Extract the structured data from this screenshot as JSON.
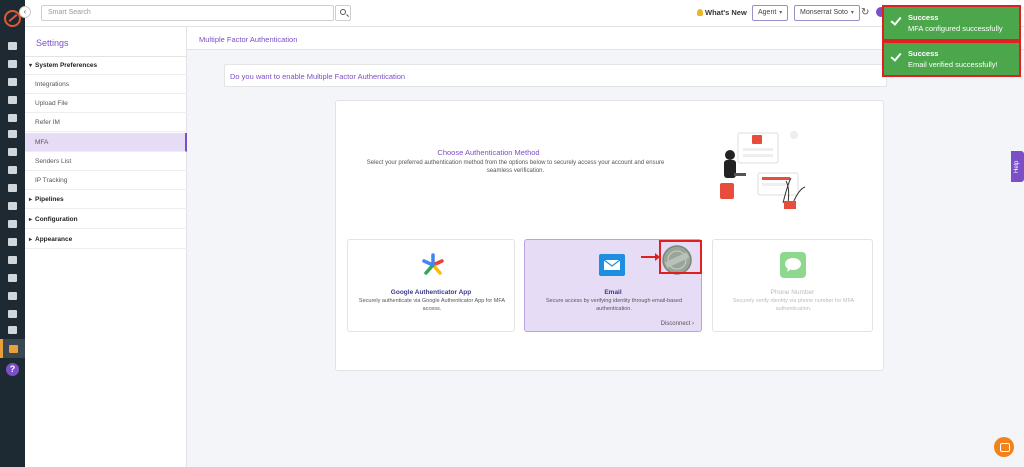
{
  "topbar": {
    "search_placeholder": "Smart Search",
    "whats_new": "What's New",
    "role_select": "Agent",
    "user_select": "Monserrat Soto"
  },
  "settings": {
    "title": "Settings",
    "items": [
      {
        "label": "System Preferences",
        "type": "group",
        "open": true
      },
      {
        "label": "Integrations",
        "type": "item"
      },
      {
        "label": "Upload File",
        "type": "item"
      },
      {
        "label": "Refer IM",
        "type": "item"
      },
      {
        "label": "MFA",
        "type": "item",
        "active": true
      },
      {
        "label": "Senders List",
        "type": "item"
      },
      {
        "label": "IP Tracking",
        "type": "item"
      },
      {
        "label": "Pipelines",
        "type": "group"
      },
      {
        "label": "Configuration",
        "type": "group"
      },
      {
        "label": "Appearance",
        "type": "group"
      }
    ]
  },
  "main": {
    "title": "Multiple Factor Authentication",
    "question": "Do you want to enable Multiple Factor Authentication",
    "method_title": "Choose Authentication Method",
    "method_subtitle": "Select your preferred authentication method from the options below to securely access your account and ensure seamless verification.",
    "options": [
      {
        "name": "Google Authenticator App",
        "desc": "Securely authenticate via Google Authenticator App for MFA access.",
        "icon": "google-authenticator-icon"
      },
      {
        "name": "Email",
        "desc": "Secure access by verifying identity through email-based authentication.",
        "icon": "email-icon",
        "selected": true,
        "action": "Disconnect"
      },
      {
        "name": "Phone Number",
        "desc": "Securely verify identity via phone number for MFA authentication.",
        "icon": "phone-message-icon",
        "disabled": true
      }
    ]
  },
  "toasts": [
    {
      "title": "Success",
      "message": "MFA configured successfully"
    },
    {
      "title": "Success",
      "message": "Email verified successfully!"
    }
  ],
  "help_tab": "Help",
  "colors": {
    "accent": "#7b4fc7",
    "success": "#4ca64c",
    "highlight": "#e02020"
  }
}
